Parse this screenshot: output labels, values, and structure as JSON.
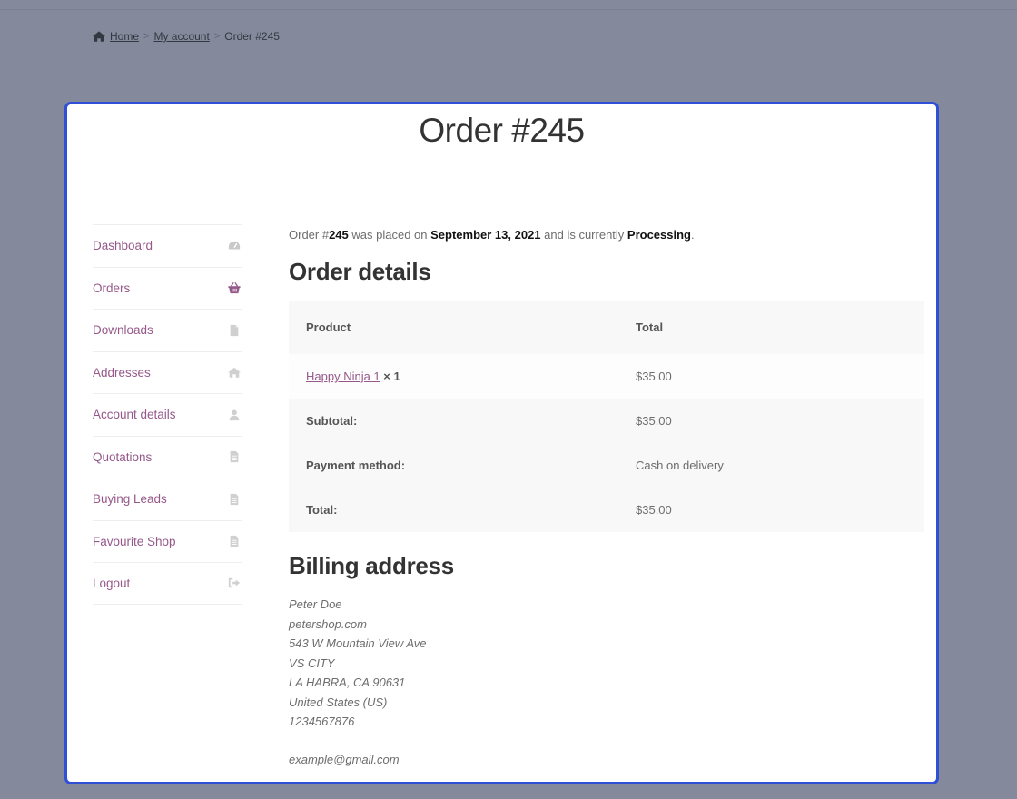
{
  "breadcrumb": {
    "home": "Home",
    "my_account": "My account",
    "current": "Order #245",
    "separator": ">"
  },
  "page_title": "Order #245",
  "nav": [
    {
      "label": "Dashboard",
      "icon": "dashboard-icon",
      "active": false
    },
    {
      "label": "Orders",
      "icon": "basket-icon",
      "active": true
    },
    {
      "label": "Downloads",
      "icon": "file-icon",
      "active": false
    },
    {
      "label": "Addresses",
      "icon": "home-icon",
      "active": false
    },
    {
      "label": "Account details",
      "icon": "user-icon",
      "active": false
    },
    {
      "label": "Quotations",
      "icon": "document-icon",
      "active": false
    },
    {
      "label": "Buying Leads",
      "icon": "document-icon",
      "active": false
    },
    {
      "label": "Favourite Shop",
      "icon": "document-icon",
      "active": false
    },
    {
      "label": "Logout",
      "icon": "logout-icon",
      "active": false
    }
  ],
  "status": {
    "prefix": "Order #",
    "order_number": "245",
    "placed_text": " was placed on ",
    "date": "September 13, 2021",
    "status_text": " and is currently ",
    "status": "Processing",
    "suffix": "."
  },
  "order_details": {
    "heading": "Order details",
    "col_product": "Product",
    "col_total": "Total",
    "items": [
      {
        "name": "Happy Ninja 1",
        "qty": "× 1",
        "total": "$35.00"
      }
    ],
    "subtotal_label": "Subtotal:",
    "subtotal_value": "$35.00",
    "payment_label": "Payment method:",
    "payment_value": "Cash on delivery",
    "total_label": "Total:",
    "total_value": "$35.00"
  },
  "billing": {
    "heading": "Billing address",
    "name": "Peter Doe",
    "company": "petershop.com",
    "street": "543 W Mountain View Ave",
    "city_line": "VS CITY",
    "region": "LA HABRA, CA 90631",
    "country": "United States (US)",
    "phone": "1234567876",
    "email": "example@gmail.com"
  },
  "colors": {
    "accent": "#96588a",
    "frame": "#2f4fd6",
    "backdrop": "#848a9c"
  }
}
